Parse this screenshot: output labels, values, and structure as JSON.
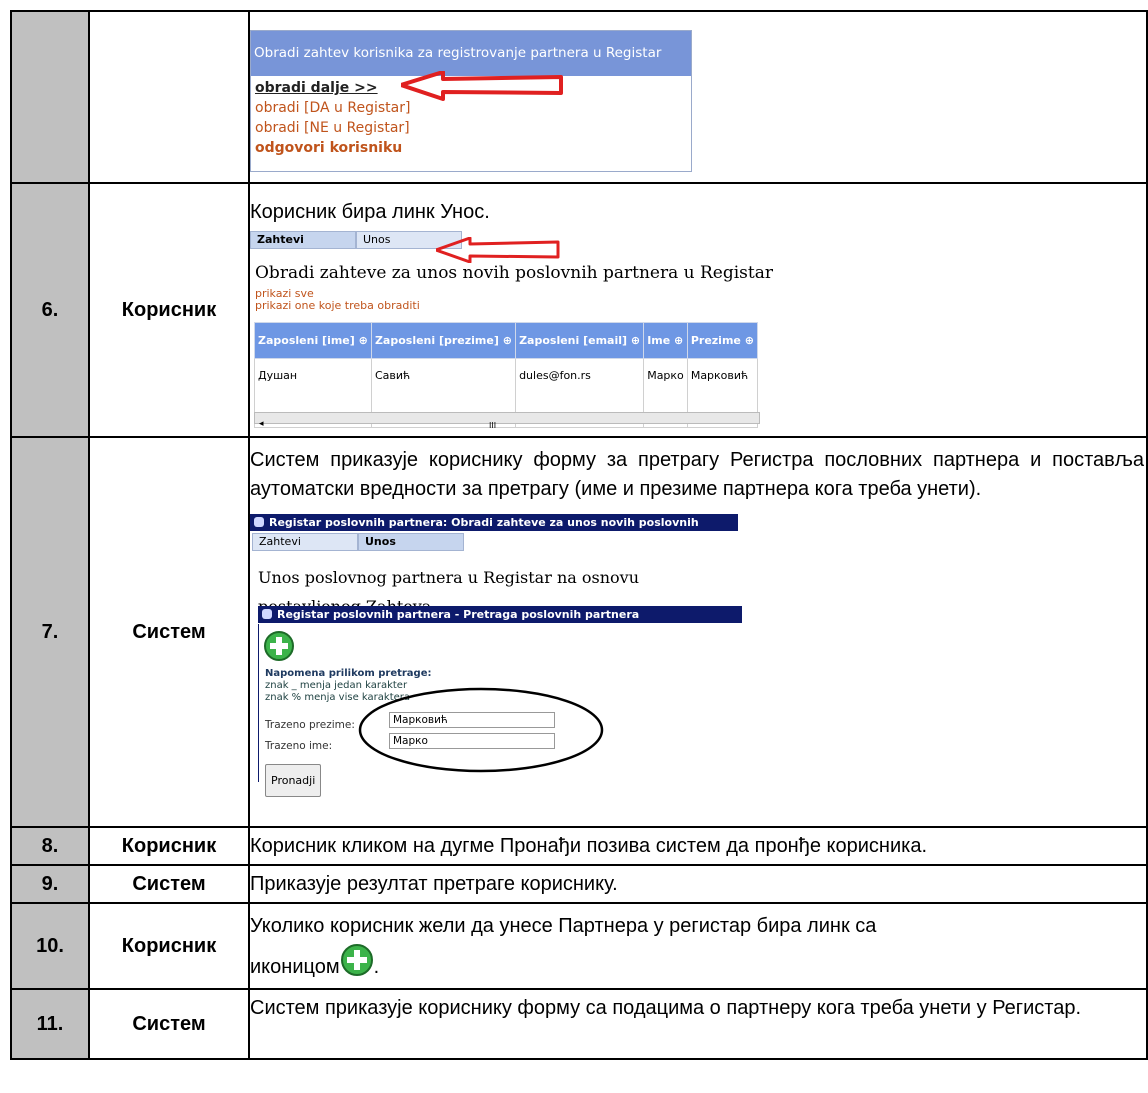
{
  "rows": [
    {
      "num": "",
      "actor": "",
      "shot": {
        "header": "Obradi zahtev korisnika za registrovanje partnera u Registar",
        "links": [
          "obradi dalje >>",
          "obradi [DA u Registar]",
          "obradi [NE u Registar]",
          "odgovori korisniku"
        ]
      }
    },
    {
      "num": "6.",
      "actor": "Корисник",
      "text": "Корисник бира линк Унос.",
      "shot": {
        "tabs": [
          "Zahtevi",
          "Unos"
        ],
        "title": "Obradi zahteve za unos novih poslovnih partnera u Registar",
        "links": [
          "prikazi sve",
          "prikazi one koje treba obraditi"
        ],
        "columns": [
          "Zaposleni [ime]",
          "Zaposleni [prezime]",
          "Zaposleni [email]",
          "Ime",
          "Prezime"
        ],
        "cells": [
          "Душан",
          "Савић",
          "dules@fon.rs",
          "Марко",
          "Марковић"
        ],
        "scroll_glyph": "III"
      }
    },
    {
      "num": "7.",
      "actor": "Систем",
      "text": "Систем приказује кориснику форму за претрагу Регистра пословних партнера и поставља аутоматски вредности за претрагу (име и презиме партнера кога треба унети).",
      "shot": {
        "window_title": "Registar poslovnih partnera: Obradi zahteve za unos novih poslovnih partnera",
        "tabs": [
          "Zahtevi",
          "Unos"
        ],
        "title": "Unos poslovnog partnera u Registar na osnovu postavljenog Zahteva",
        "inner_title": "Registar poslovnih partnera - Pretraga poslovnih partnera",
        "note_title": "Napomena prilikom pretrage:",
        "note_lines": [
          "znak _ menja jedan karakter",
          "znak % menja vise karaktera"
        ],
        "label_prezime": "Trazeno prezime:",
        "value_prezime": "Марковић",
        "label_ime": "Trazeno ime:",
        "value_ime": "Марко",
        "button": "Pronadji"
      }
    },
    {
      "num": "8.",
      "actor": "Корисник",
      "text": "Корисник кликом на дугме Пронађи позива систем да пронђе корисника."
    },
    {
      "num": "9.",
      "actor": "Систем",
      "text": "Приказује резултат претраге кориснику."
    },
    {
      "num": "10.",
      "actor": "Корисник",
      "text": "Уколико корисник жели да унесе Партнера у регистар бира линк са",
      "text_icon": "иконицом",
      "text_end": "."
    },
    {
      "num": "11.",
      "actor": "Систем",
      "text": "Систем приказује кориснику форму са подацима о партнеру кога треба унети у Регистар."
    }
  ],
  "icons": {
    "plus": "plus-circle-icon",
    "arrow": "red-arrow-icon",
    "ellipse": "ellipse-highlight"
  },
  "colors": {
    "num_bg": "#c0c0c0",
    "header_blue": "#7895d8",
    "navy": "#0d1a6b",
    "link_orange": "#c0541c",
    "arrow_red": "#e02020",
    "plus_green": "#3cb34a"
  }
}
